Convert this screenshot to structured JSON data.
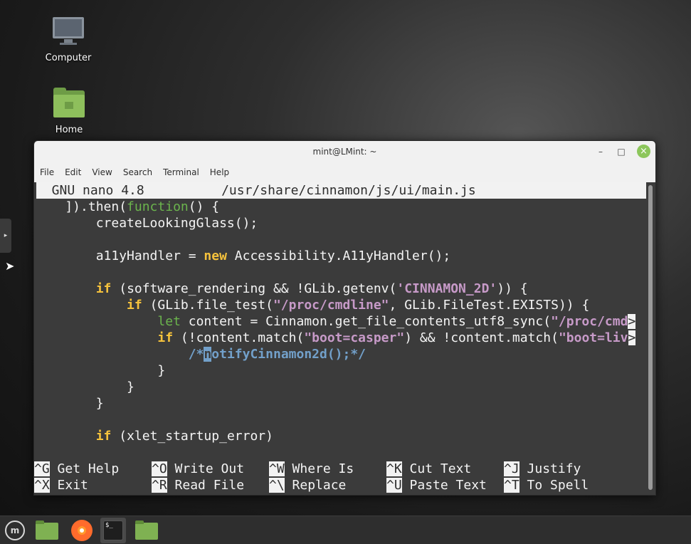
{
  "desktop": {
    "icons": [
      {
        "label": "Computer"
      },
      {
        "label": "Home"
      }
    ]
  },
  "window": {
    "title": "mint@LMint: ~",
    "minimize_glyph": "–",
    "maximize_glyph": "□",
    "close_glyph": "×"
  },
  "menubar": {
    "items": [
      "File",
      "Edit",
      "View",
      "Search",
      "Terminal",
      "Help"
    ]
  },
  "nano": {
    "header": "  GNU nano 4.8          /usr/share/cinnamon/js/ui/main.js",
    "code": {
      "l1_a": "    ]).then(",
      "l1_fn": "function",
      "l1_b": "() {",
      "l2": "        createLookingGlass();",
      "l4_a": "        a11yHandler = ",
      "l4_kw": "new",
      "l4_b": " Accessibility.A11yHandler();",
      "l6_pre": "        ",
      "l6_kw": "if",
      "l6_a": " (software_rendering && !GLib.getenv(",
      "l6_str": "'CINNAMON_2D'",
      "l6_b": ")) {",
      "l7_pre": "            ",
      "l7_kw": "if",
      "l7_a": " (GLib.file_test(",
      "l7_str": "\"/proc/cmdline\"",
      "l7_b": ", GLib.FileTest.EXISTS)) {",
      "l8_pre": "                ",
      "l8_kw": "let",
      "l8_a": " content = Cinnamon.get_file_contents_utf8_sync(",
      "l8_str": "\"/proc/cmd",
      "l8_trunc": ">",
      "l9_pre": "                ",
      "l9_kw": "if",
      "l9_a": " (!content.match(",
      "l9_str1": "\"boot=casper\"",
      "l9_b": ") && !content.match(",
      "l9_str2": "\"boot=liv",
      "l9_trunc": ">",
      "l10_pre": "                    ",
      "l10_c1": "/*",
      "l10_cursor": "n",
      "l10_c2": "otifyCinnamon2d();*/",
      "l11": "                }",
      "l12": "            }",
      "l13": "        }",
      "l15_pre": "        ",
      "l15_kw": "if",
      "l15_a": " (xlet_startup_error)"
    },
    "shortcuts": [
      {
        "key": "^G",
        "label": " Get Help"
      },
      {
        "key": "^O",
        "label": " Write Out"
      },
      {
        "key": "^W",
        "label": " Where Is"
      },
      {
        "key": "^K",
        "label": " Cut Text"
      },
      {
        "key": "^J",
        "label": " Justify"
      },
      {
        "key": "^X",
        "label": " Exit"
      },
      {
        "key": "^R",
        "label": " Read File"
      },
      {
        "key": "^\\",
        "label": " Replace"
      },
      {
        "key": "^U",
        "label": " Paste Text"
      },
      {
        "key": "^T",
        "label": " To Spell"
      }
    ]
  },
  "taskbar": {
    "menu_glyph": "m",
    "terminal_glyph": "$_"
  },
  "colors": {
    "terminal_bg": "#3b3b3b",
    "keyword": "#f5c23c",
    "function": "#6bb44d",
    "string": "#c79ac8",
    "comment": "#72a0ca",
    "taskbar": "#2e2e2e"
  },
  "icons": [
    "computer-icon",
    "home-folder-icon",
    "mint-menu-icon",
    "files-icon",
    "firefox-icon",
    "terminal-icon",
    "folder-icon"
  ]
}
